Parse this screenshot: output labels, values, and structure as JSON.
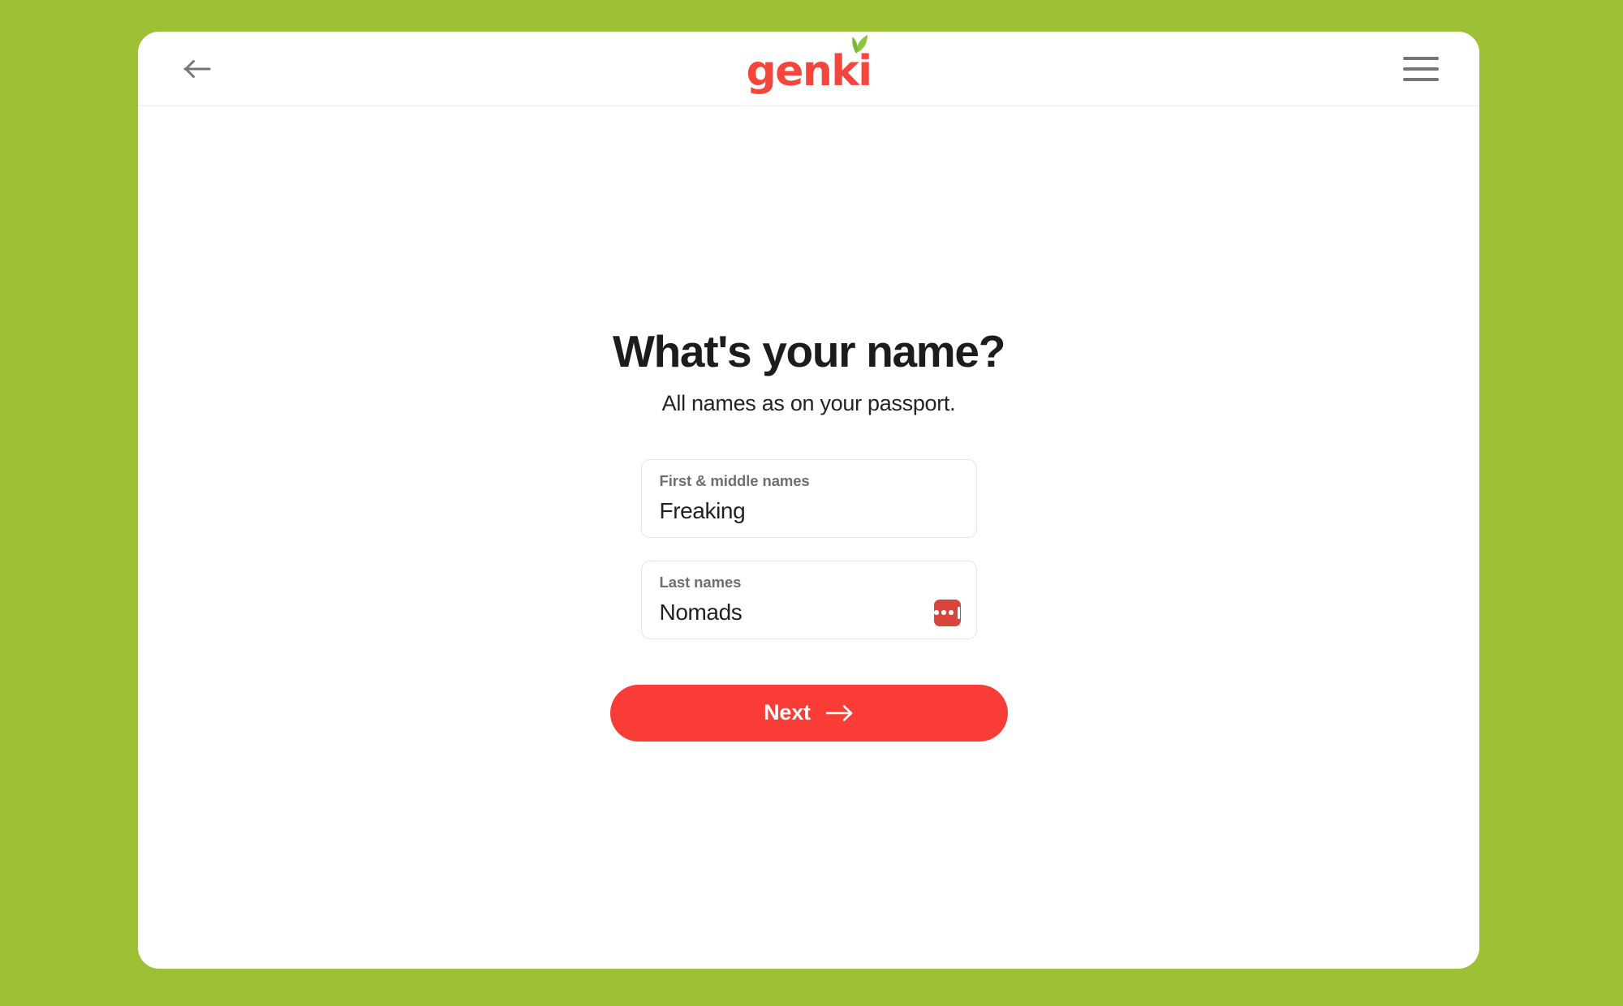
{
  "theme": {
    "background_color": "#9dc134",
    "card_color": "#ffffff",
    "brand_red": "#f4463c",
    "button_red": "#fa3c36",
    "lastpass_red": "#d9453c",
    "leaf_green": "#8cc63e",
    "icon_gray": "#767676",
    "label_gray": "#6d6f74",
    "border_gray": "#e3e4e6"
  },
  "header": {
    "back_label": "Back",
    "back_icon": "arrow-left-icon",
    "brand_name": "genki",
    "brand_leaf_icon": "leaf-icon",
    "menu_label": "Menu",
    "menu_icon": "hamburger-menu-icon"
  },
  "main": {
    "title": "What's your name?",
    "subtitle": "All names as on your passport.",
    "fields": [
      {
        "name": "first-middle-names",
        "label": "First & middle names",
        "value": "Freaking",
        "placeholder": "First & middle names",
        "has_autofill_badge": false
      },
      {
        "name": "last-names",
        "label": "Last names",
        "value": "Nomads",
        "placeholder": "Last names",
        "has_autofill_badge": true
      }
    ],
    "autofill_badge": {
      "icon": "lastpass-icon",
      "title": "LastPass autofill",
      "dots": 3
    },
    "primary_action": {
      "label": "Next",
      "icon": "arrow-right-icon"
    }
  }
}
